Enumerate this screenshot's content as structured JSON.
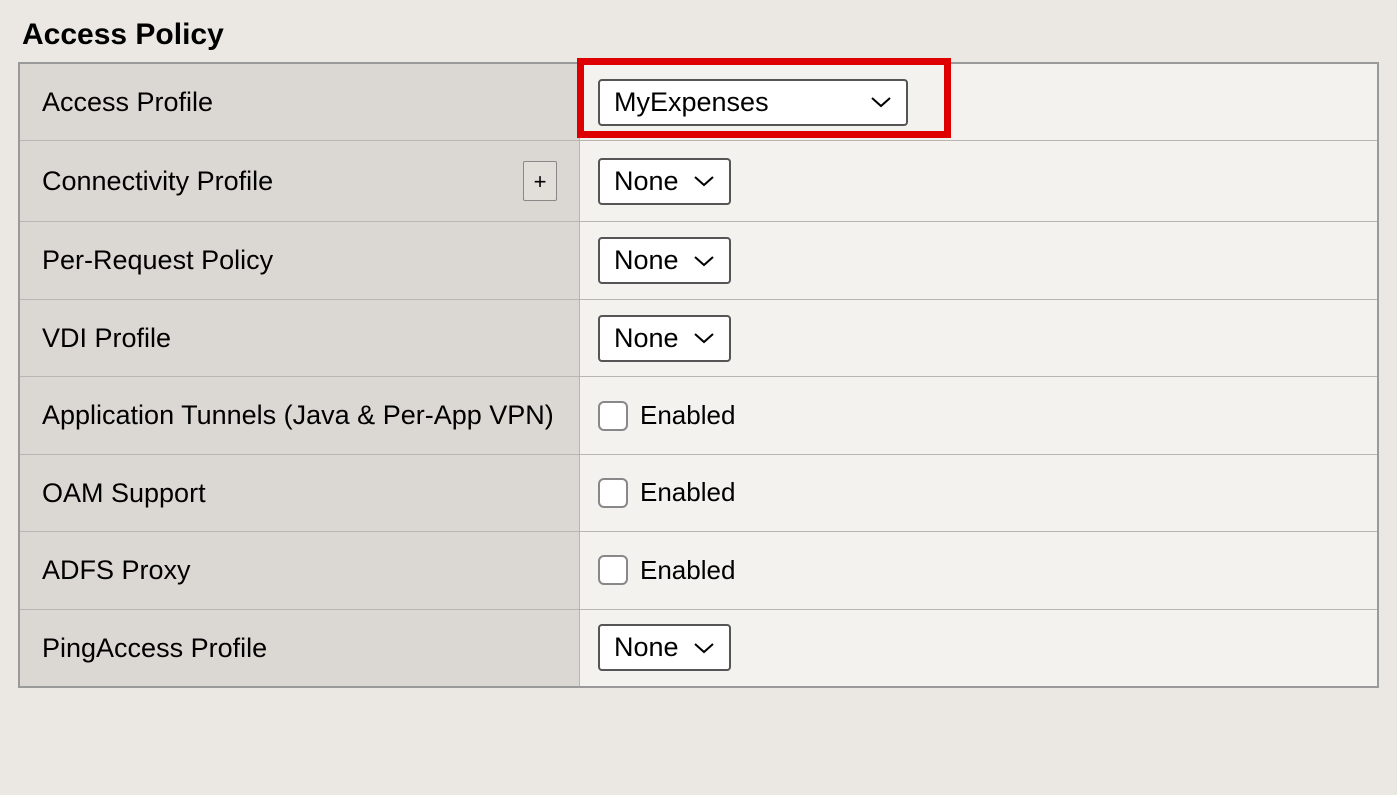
{
  "section_title": "Access Policy",
  "rows": {
    "access_profile": {
      "label": "Access Profile",
      "value": "MyExpenses"
    },
    "connectivity_profile": {
      "label": "Connectivity Profile",
      "value": "None",
      "plus": "+"
    },
    "per_request_policy": {
      "label": "Per-Request Policy",
      "value": "None"
    },
    "vdi_profile": {
      "label": "VDI Profile",
      "value": "None"
    },
    "app_tunnels": {
      "label": "Application Tunnels (Java & Per-App VPN)",
      "checkbox_label": "Enabled"
    },
    "oam_support": {
      "label": "OAM Support",
      "checkbox_label": "Enabled"
    },
    "adfs_proxy": {
      "label": "ADFS Proxy",
      "checkbox_label": "Enabled"
    },
    "pingaccess_profile": {
      "label": "PingAccess Profile",
      "value": "None"
    }
  }
}
